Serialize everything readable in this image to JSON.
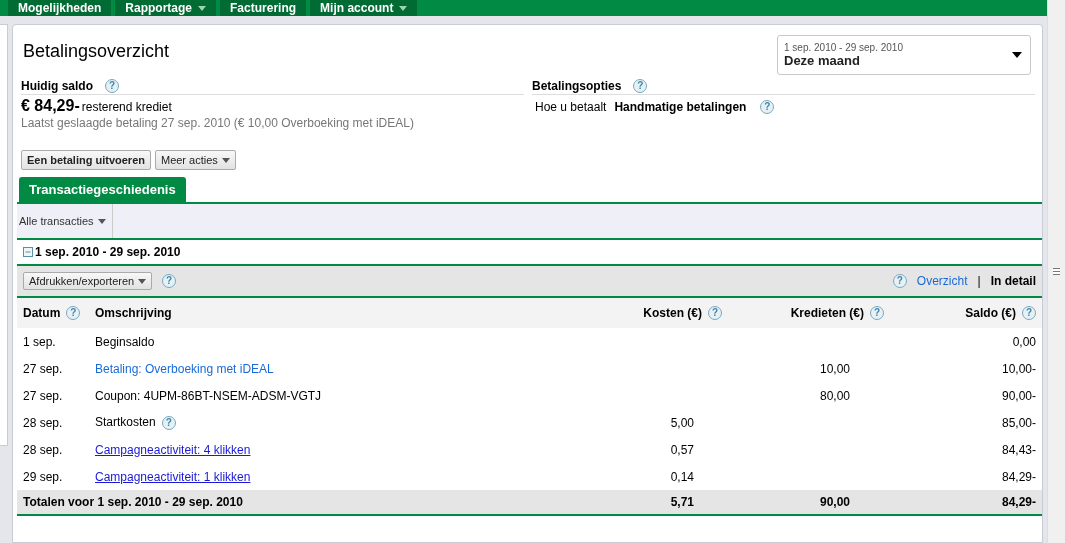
{
  "nav": [
    {
      "label": "Mogelijkheden",
      "dropdown": false
    },
    {
      "label": "Rapportage",
      "dropdown": true
    },
    {
      "label": "Facturering",
      "dropdown": false
    },
    {
      "label": "Mijn account",
      "dropdown": true
    }
  ],
  "title": "Betalingsoverzicht",
  "date_range": {
    "range": "1 sep. 2010 - 29 sep. 2010",
    "value": "Deze maand"
  },
  "balance": {
    "heading": "Huidig saldo",
    "help": "?",
    "amount": "€ 84,29-",
    "amount_note": "resterend krediet",
    "last_payment": "Laatst geslaagde betaling 27 sep. 2010 (€ 10,00 Overboeking met iDEAL)"
  },
  "payment_options": {
    "heading": "Betalingsopties",
    "help": "?",
    "label": "Hoe u betaalt",
    "value": "Handmatige betalingen",
    "value_help": "?"
  },
  "actions": [
    {
      "label": "Een betaling uitvoeren",
      "kind": "primary"
    },
    {
      "label": "Meer acties",
      "kind": "menu"
    }
  ],
  "tabs": [
    {
      "label": "Transactiegeschiedenis",
      "selected": true
    }
  ],
  "filter": "Alle transacties",
  "period": "1 sep. 2010 - 29 sep. 2010",
  "export_button": "Afdrukken/exporteren",
  "export_help": "?",
  "view_help": "?",
  "view_options": [
    {
      "label": "Overzicht",
      "selected": false
    },
    {
      "label": "In detail",
      "selected": true
    }
  ],
  "view_separator": "|",
  "table": {
    "columns": [
      {
        "label": "Datum",
        "help": "?"
      },
      {
        "label": "Omschrijving"
      },
      {
        "label": "Kosten (€)",
        "help": "?"
      },
      {
        "label": "Kredieten (€)",
        "help": "?"
      },
      {
        "label": "Saldo (€)",
        "help": "?"
      }
    ],
    "rows": [
      {
        "date": "1 sep.",
        "description": "Beginsaldo",
        "kind": "text",
        "costs": "",
        "credits": "",
        "balance": "0,00"
      },
      {
        "date": "27 sep.",
        "description": "Betaling: Overboeking met iDEAL",
        "kind": "link",
        "costs": "",
        "credits": "10,00",
        "balance": "10,00-"
      },
      {
        "date": "27 sep.",
        "description": "Coupon: 4UPM-86BT-NSEM-ADSM-VGTJ",
        "kind": "text",
        "costs": "",
        "credits": "80,00",
        "balance": "90,00-"
      },
      {
        "date": "28 sep.",
        "description": "Startkosten",
        "kind": "text",
        "help": "?",
        "costs": "5,00",
        "credits": "",
        "balance": "85,00-"
      },
      {
        "date": "28 sep.",
        "description": "Campagneactiviteit: 4 klikken",
        "kind": "underlined_link",
        "costs": "0,57",
        "credits": "",
        "balance": "84,43-"
      },
      {
        "date": "29 sep.",
        "description": "Campagneactiviteit: 1 klikken",
        "kind": "underlined_link",
        "costs": "0,14",
        "credits": "",
        "balance": "84,29-"
      }
    ],
    "totals": {
      "label": "Totalen voor 1 sep. 2010 - 29 sep. 2010",
      "costs": "5,71",
      "credits": "90,00",
      "balance": "84,29-"
    }
  }
}
